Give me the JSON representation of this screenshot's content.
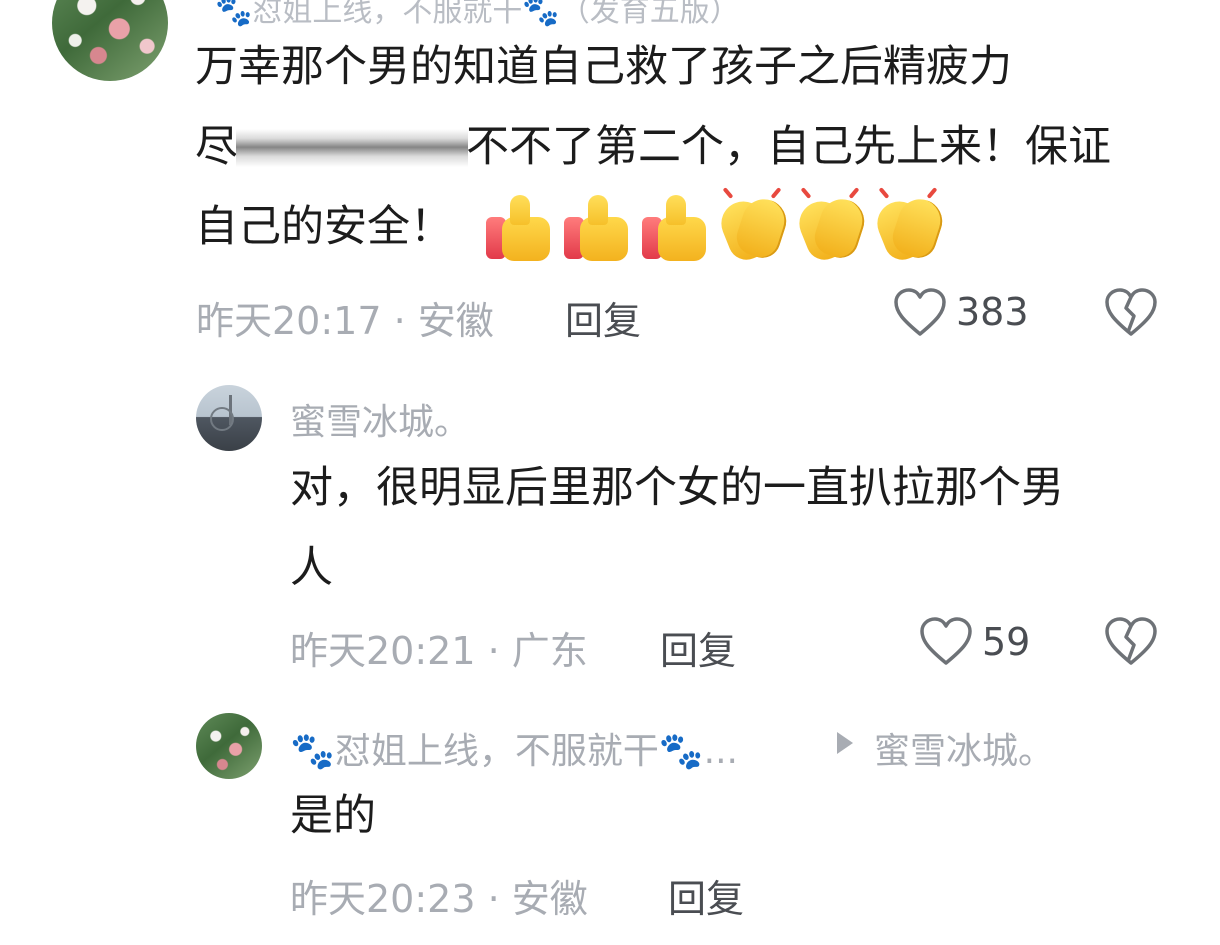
{
  "top_comment": {
    "partial_author": "🐾怼姐上线，不服就干🐾（发育五版）",
    "lines": [
      "万幸那个男的知道自己救了孩子之后精疲力",
      "尽",
      "不不了第二个，自己先上来！保证",
      "自己的安全！"
    ],
    "emojis": [
      "thumbs-up",
      "thumbs-up",
      "thumbs-up",
      "clapping-hands",
      "clapping-hands",
      "clapping-hands"
    ],
    "time": "昨天20:17",
    "location": "安徽",
    "reply_label": "回复",
    "likes": "383"
  },
  "replies": [
    {
      "author": "蜜雪冰城。",
      "lines": [
        "对，很明显后里那个女的一直扒拉那个男",
        "人"
      ],
      "time": "昨天20:21",
      "location": "广东",
      "reply_label": "回复",
      "likes": "59"
    },
    {
      "author": "🐾怼姐上线，不服就干🐾...",
      "reply_to": "蜜雪冰城。",
      "lines": [
        "是的"
      ],
      "time": "昨天20:23",
      "location": "安徽",
      "reply_label": "回复"
    }
  ],
  "separator": "·"
}
